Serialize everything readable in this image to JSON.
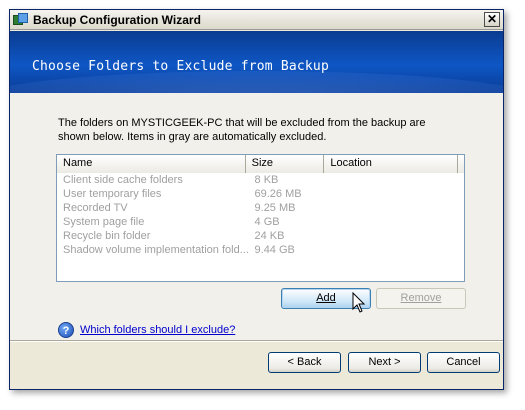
{
  "window": {
    "title": "Backup Configuration Wizard",
    "close_glyph": "✕"
  },
  "banner": {
    "title": "Choose Folders to Exclude from  Backup"
  },
  "intro_text": "The folders on MYSTICGEEK-PC that will be excluded from the backup are shown below. Items in gray are automatically excluded.",
  "table": {
    "columns": [
      "Name",
      "Size",
      "Location"
    ],
    "rows": [
      {
        "name": "Client side cache folders",
        "size": "8 KB",
        "location": ""
      },
      {
        "name": "User temporary files",
        "size": "69.26 MB",
        "location": ""
      },
      {
        "name": "Recorded TV",
        "size": "9.25 MB",
        "location": ""
      },
      {
        "name": "System page file",
        "size": "4 GB",
        "location": ""
      },
      {
        "name": "Recycle bin folder",
        "size": "24 KB",
        "location": ""
      },
      {
        "name": "Shadow volume implementation fold...",
        "size": "9.44 GB",
        "location": ""
      }
    ]
  },
  "buttons": {
    "add": "Add",
    "remove": "Remove",
    "back": "< Back",
    "next": "Next >",
    "cancel": "Cancel"
  },
  "help": {
    "link": "Which folders should I exclude?",
    "icon_glyph": "?"
  },
  "colors": {
    "banner": "#0E56C4",
    "link": "#0000CC",
    "disabled_text": "#A0A0A0"
  },
  "icons": {
    "app": "backup-app-icon",
    "help": "help-icon",
    "close": "close-icon"
  }
}
